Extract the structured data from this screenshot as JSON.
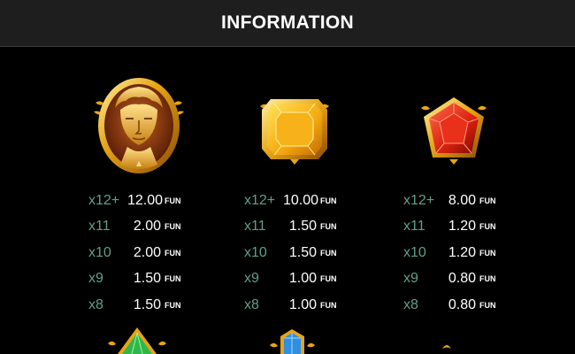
{
  "header": {
    "title": "INFORMATION"
  },
  "currency": "FUN",
  "colors": {
    "multiplier": "#5fa08a",
    "amount": "#ffffff",
    "header_bg": "#1e1e1e",
    "background": "#000000",
    "gold": "#e8a417"
  },
  "symbols": [
    {
      "icon": "golden-bust-medallion-icon",
      "payouts": [
        {
          "multiplier": "x12+",
          "amount": "12.00",
          "currency": "FUN"
        },
        {
          "multiplier": "x11",
          "amount": "2.00",
          "currency": "FUN"
        },
        {
          "multiplier": "x10",
          "amount": "2.00",
          "currency": "FUN"
        },
        {
          "multiplier": "x9",
          "amount": "1.50",
          "currency": "FUN"
        },
        {
          "multiplier": "x8",
          "amount": "1.50",
          "currency": "FUN"
        }
      ]
    },
    {
      "icon": "yellow-gem-icon",
      "payouts": [
        {
          "multiplier": "x12+",
          "amount": "10.00",
          "currency": "FUN"
        },
        {
          "multiplier": "x11",
          "amount": "1.50",
          "currency": "FUN"
        },
        {
          "multiplier": "x10",
          "amount": "1.50",
          "currency": "FUN"
        },
        {
          "multiplier": "x9",
          "amount": "1.00",
          "currency": "FUN"
        },
        {
          "multiplier": "x8",
          "amount": "1.00",
          "currency": "FUN"
        }
      ]
    },
    {
      "icon": "red-gem-icon",
      "payouts": [
        {
          "multiplier": "x12+",
          "amount": "8.00",
          "currency": "FUN"
        },
        {
          "multiplier": "x11",
          "amount": "1.20",
          "currency": "FUN"
        },
        {
          "multiplier": "x10",
          "amount": "1.20",
          "currency": "FUN"
        },
        {
          "multiplier": "x9",
          "amount": "0.80",
          "currency": "FUN"
        },
        {
          "multiplier": "x8",
          "amount": "0.80",
          "currency": "FUN"
        }
      ]
    }
  ],
  "partial_symbols": [
    {
      "icon": "green-gem-icon"
    },
    {
      "icon": "blue-gem-icon"
    },
    {
      "icon": "gold-ornament-icon"
    }
  ]
}
